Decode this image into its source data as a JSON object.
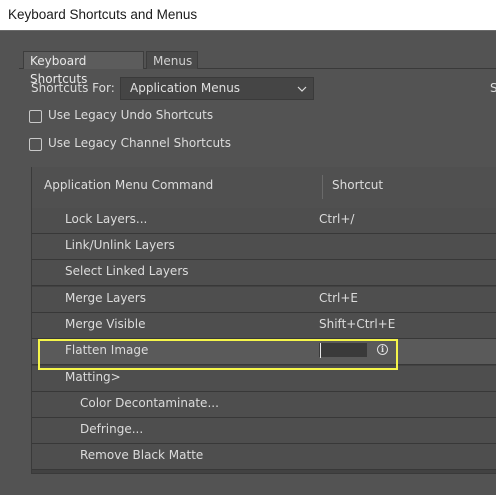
{
  "window": {
    "title": "Keyboard Shortcuts and Menus"
  },
  "tabs": [
    {
      "label": "Keyboard Shortcuts",
      "active": true
    },
    {
      "label": "Menus",
      "active": false
    }
  ],
  "shortcuts_for": {
    "label": "Shortcuts For:",
    "value": "Application Menus"
  },
  "checkboxes": [
    {
      "label": "Use Legacy Undo Shortcuts",
      "checked": false
    },
    {
      "label": "Use Legacy Channel Shortcuts",
      "checked": false
    }
  ],
  "edge_text": "S",
  "table": {
    "columns": [
      "Application Menu Command",
      "Shortcut"
    ],
    "rows": [
      {
        "command": "Lock Layers...",
        "shortcut": "Ctrl+/"
      },
      {
        "command": "Link/Unlink Layers",
        "shortcut": ""
      },
      {
        "command": "Select Linked Layers",
        "shortcut": ""
      },
      {
        "command": "Merge Layers",
        "shortcut": "Ctrl+E"
      },
      {
        "command": "Merge Visible",
        "shortcut": "Shift+Ctrl+E"
      },
      {
        "command": "Flatten Image",
        "shortcut": "",
        "selected": true,
        "editing": true
      },
      {
        "command": "Matting>",
        "shortcut": ""
      },
      {
        "command": "Color Decontaminate...",
        "shortcut": ""
      },
      {
        "command": "Defringe...",
        "shortcut": ""
      },
      {
        "command": "Remove Black Matte",
        "shortcut": ""
      }
    ]
  },
  "colors": {
    "highlight": "#f5f54a",
    "background": "#535353"
  },
  "icons": {
    "info": "info-icon",
    "dropdown": "chevron-down-icon"
  }
}
